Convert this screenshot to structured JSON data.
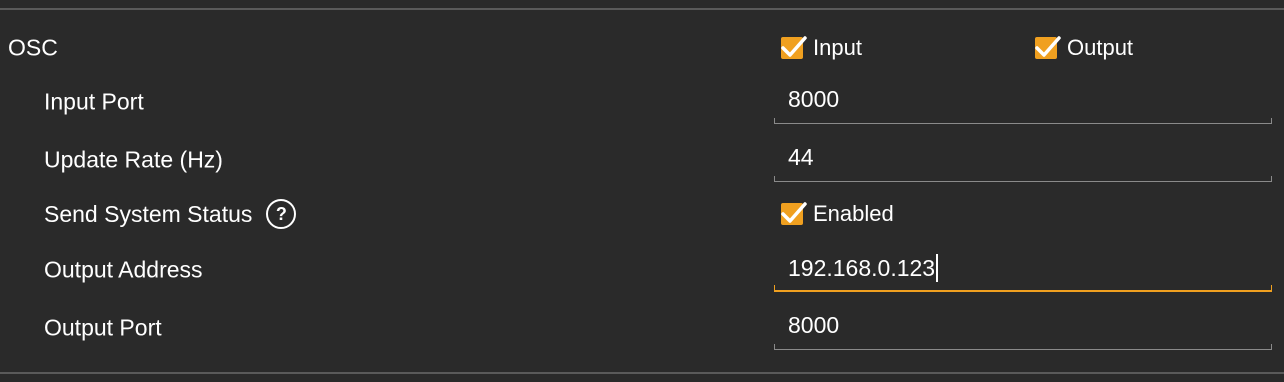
{
  "section": {
    "title": "OSC",
    "input_checkbox": {
      "label": "Input",
      "checked": true
    },
    "output_checkbox": {
      "label": "Output",
      "checked": true
    }
  },
  "rows": {
    "input_port": {
      "label": "Input Port",
      "value": "8000"
    },
    "update_rate": {
      "label": "Update Rate (Hz)",
      "value": "44"
    },
    "send_system_status": {
      "label": "Send System Status",
      "help_glyph": "?",
      "checkbox_label": "Enabled",
      "checked": true
    },
    "output_address": {
      "label": "Output Address",
      "value": "192.168.0.123",
      "focused": true
    },
    "output_port": {
      "label": "Output Port",
      "value": "8000"
    }
  },
  "colors": {
    "background": "#2a2a2a",
    "accent": "#f0a020",
    "text": "#ffffff",
    "divider": "#5a5a5a",
    "underline": "#8a8a8a"
  },
  "icons": {
    "checkbox": "checkmark-icon",
    "help": "help-circle-icon"
  }
}
